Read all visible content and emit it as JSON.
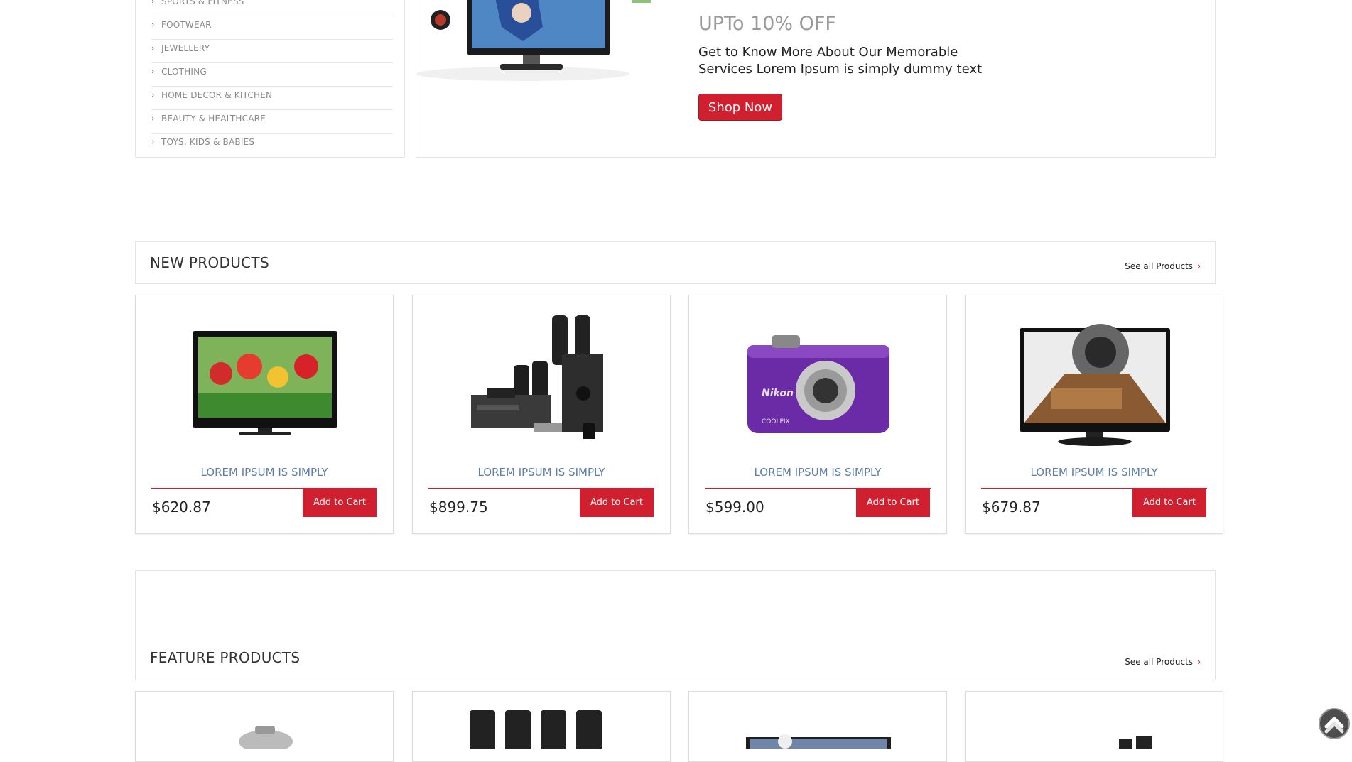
{
  "sidebar": {
    "items": [
      {
        "label": "SPORTS & FITNESS"
      },
      {
        "label": "FOOTWEAR"
      },
      {
        "label": "JEWELLERY"
      },
      {
        "label": "CLOTHING"
      },
      {
        "label": "HOME DECOR & KITCHEN"
      },
      {
        "label": "BEAUTY & HEALTHCARE"
      },
      {
        "label": "TOYS, KIDS & BABIES"
      }
    ],
    "chevron_icon": "chevron-right-icon"
  },
  "banner": {
    "title": "UPTo 10% OFF",
    "text": "Get to Know More About Our Memorable Services Lorem Ipsum is simply dummy text",
    "button_label": "Shop Now"
  },
  "new_products": {
    "title": "NEW PRODUCTS",
    "see_all": "See all Products",
    "items": [
      {
        "name": "LOREM IPSUM IS SIMPLY",
        "price": "$620.87",
        "cart_label": "Add to Cart",
        "image": "tv-flowers"
      },
      {
        "name": "LOREM IPSUM IS SIMPLY",
        "price": "$899.75",
        "cart_label": "Add to Cart",
        "image": "home-theater"
      },
      {
        "name": "LOREM IPSUM IS SIMPLY",
        "price": "$599.00",
        "cart_label": "Add to Cart",
        "image": "nikon-camera"
      },
      {
        "name": "LOREM IPSUM IS SIMPLY",
        "price": "$679.87",
        "cart_label": "Add to Cart",
        "image": "tv-dome"
      }
    ]
  },
  "feature_products": {
    "title": "FEATURE PRODUCTS",
    "see_all": "See all Products"
  },
  "colors": {
    "accent": "#d01f2e",
    "product_name": "#5c7fa8",
    "promo_title": "#9a9a9a"
  }
}
